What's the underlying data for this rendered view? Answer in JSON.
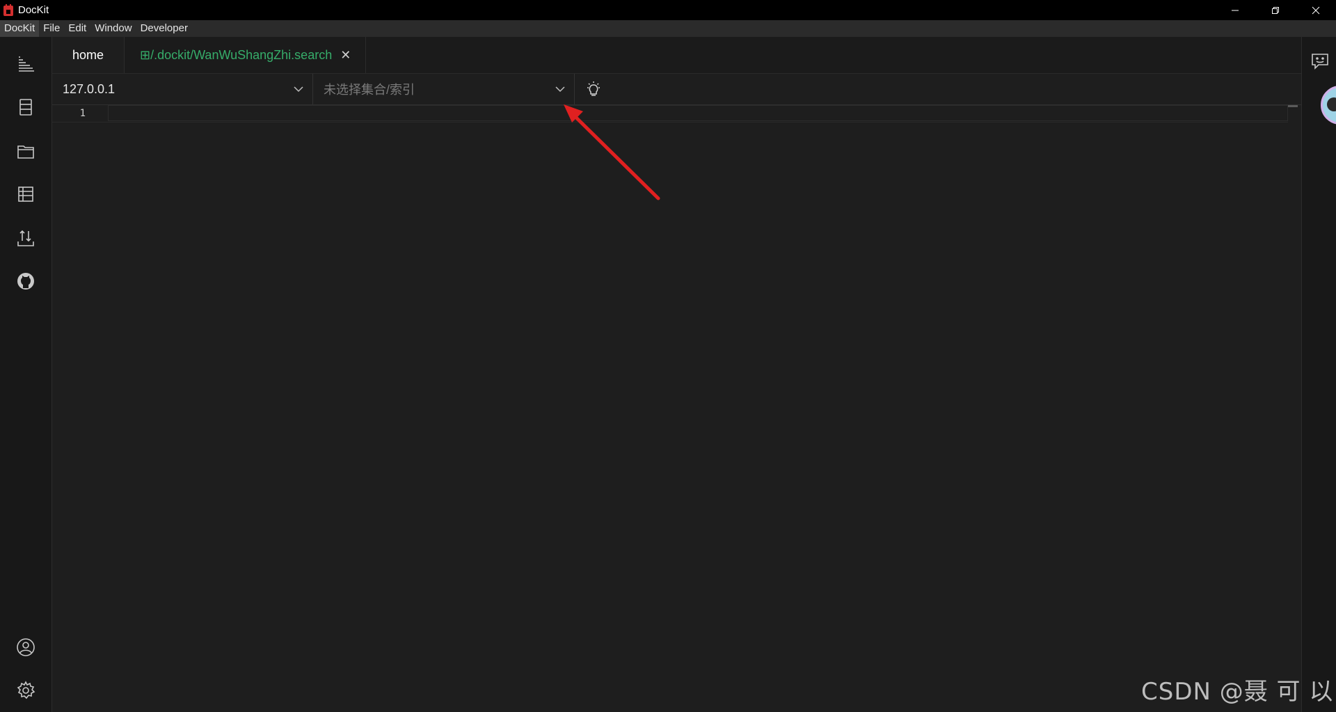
{
  "window": {
    "title": "DocKit",
    "brand_color": "#d32f2f",
    "controls": [
      "minimize-icon",
      "restore-icon",
      "close-icon"
    ]
  },
  "menu": {
    "items": [
      "DocKit",
      "File",
      "Edit",
      "Window",
      "Developer"
    ],
    "active": "DocKit"
  },
  "sidebar": {
    "top_icons": [
      "chart-list-icon",
      "database-icon",
      "folder-icon",
      "history-icon",
      "import-export-icon",
      "github-icon"
    ],
    "bottom_icons": [
      "user-icon",
      "settings-icon"
    ]
  },
  "rightbar": {
    "icons": [
      "feedback-icon",
      "avatar"
    ]
  },
  "tabs": [
    {
      "label": "home",
      "active": true
    },
    {
      "label": "⊞/.dockit/WanWuShangZhi.search",
      "closable": true,
      "color": "#36ad6a"
    }
  ],
  "toolbar": {
    "host_value": "127.0.0.1",
    "index_placeholder": "未选择集合/索引",
    "action_icon": "lightbulb-icon"
  },
  "editor": {
    "line_numbers": [
      "1"
    ],
    "content": ""
  },
  "annotation": {
    "color": "#e02020",
    "icon": "red-arrow"
  },
  "watermark": "CSDN @聂 可 以"
}
